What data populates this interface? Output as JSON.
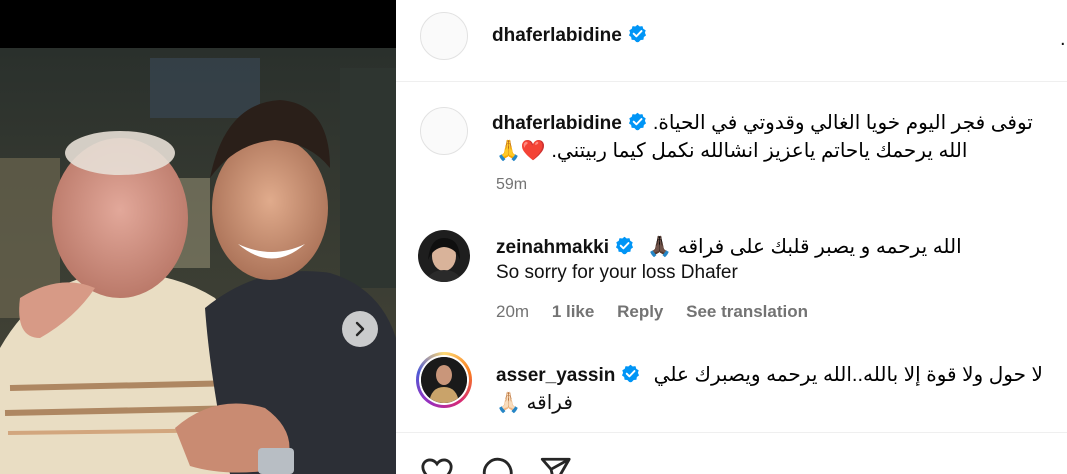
{
  "header": {
    "username": "dhaferlabidine",
    "verified_icon": "verified-badge-icon",
    "more_icon": "more-options-icon",
    "more_label": "..."
  },
  "caption": {
    "username": "dhaferlabidine",
    "text_line1": "توفى فجر اليوم خويا الغالي وقدوتي في الحياة.",
    "text_line2": "الله يرحمك ياحاتم ياعزيز انشالله نكمل كيما ربيتني. ❤️🙏",
    "time": "59m"
  },
  "comments": [
    {
      "username": "zeinahmakki",
      "text_arabic": "الله يرحمه و يصبر قلبك على فراقه 🙏🏿",
      "text_english": "So sorry for your loss Dhafer",
      "time": "20m",
      "likes": "1 like",
      "reply_label": "Reply",
      "translate_label": "See translation"
    },
    {
      "username": "asser_yassin",
      "text_line1": "لا حول ولا قوة إلا بالله..الله يرحمه ويصبرك علي",
      "text_line2": "فراقه 🙏🏻"
    }
  ],
  "photo": {
    "next_icon": "chevron-right-icon"
  },
  "actions": {
    "icons": [
      "heart-icon",
      "comment-icon",
      "share-icon"
    ]
  },
  "colors": {
    "verified_blue": "#0095f6",
    "secondary_text": "#737373",
    "divider": "#efefef"
  }
}
